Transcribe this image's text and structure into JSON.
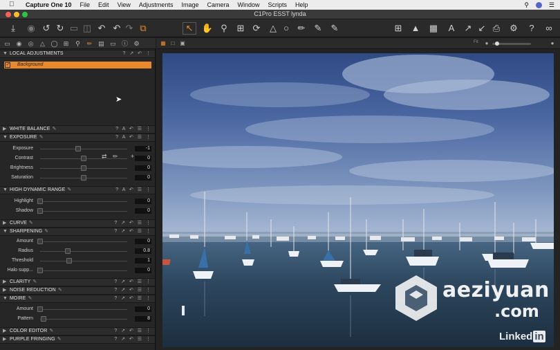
{
  "menubar": {
    "app_name": "Capture One 10",
    "items": [
      "File",
      "Edit",
      "View",
      "Adjustments",
      "Image",
      "Camera",
      "Window",
      "Scripts",
      "Help"
    ],
    "right_icons": [
      "search-icon",
      "siri-icon",
      "list-icon"
    ]
  },
  "window": {
    "title": "C1Pro ESST lynda"
  },
  "toolbar": {
    "left_icons": [
      "import-icon",
      "camera-icon",
      "rotate-left-icon",
      "rotate-right-icon",
      "folder-icon",
      "trash-icon",
      "undo-all-icon",
      "undo-icon",
      "redo-icon",
      "copy-adjustments-icon"
    ],
    "cursor_tools": [
      "select-cursor-icon",
      "pan-icon",
      "zoom-icon",
      "crop-icon",
      "rotate-icon",
      "keystone-icon",
      "spot-icon",
      "brush-icon",
      "picker-icon",
      "annotation-icon"
    ],
    "right_icons": [
      "grid-view-icon",
      "warning-icon",
      "grid-icon",
      "text-icon",
      "expand-icon",
      "collapse-icon",
      "print-icon",
      "settings-icon",
      "help-icon",
      "glasses-icon"
    ]
  },
  "tool_tabs": [
    "library-tab",
    "capture-tab",
    "color-tab",
    "exposure-tab",
    "lens-tab",
    "crop-tab",
    "details-tab",
    "local-adjustments-tab",
    "metadata-tab",
    "output-tab",
    "batch-tab",
    "tweaks-tab"
  ],
  "local_adjustments": {
    "header": "LOCAL ADJUSTMENTS",
    "layer_name": "Background"
  },
  "sections": {
    "white_balance": "WHITE BALANCE",
    "exposure": "EXPOSURE",
    "hdr": "HIGH DYNAMIC RANGE",
    "curve": "CURVE",
    "sharpening": "SHARPENING",
    "clarity": "CLARITY",
    "noise": "NOISE REDUCTION",
    "moire": "MOIRE",
    "color_editor": "COLOR EDITOR",
    "purple_fringing": "PURPLE FRINGING"
  },
  "exposure_sliders": [
    {
      "label": "Exposure",
      "value": "-1",
      "level": -0.125
    },
    {
      "label": "Contrast",
      "value": "0",
      "level": 0
    },
    {
      "label": "Brightness",
      "value": "0",
      "level": 0
    },
    {
      "label": "Saturation",
      "value": "0",
      "level": 0
    }
  ],
  "hdr_sliders": [
    {
      "label": "Highlight",
      "value": "0",
      "level": 0
    },
    {
      "label": "Shadow",
      "value": "0",
      "level": 0
    }
  ],
  "sharpening_sliders": [
    {
      "label": "Amount",
      "value": "0",
      "level": 0
    },
    {
      "label": "Radius",
      "value": "0.8",
      "level": 0.32
    },
    {
      "label": "Threshold",
      "value": "1",
      "level": 0.33
    },
    {
      "label": "Halo supp...",
      "value": "0",
      "level": 0
    }
  ],
  "moire_sliders": [
    {
      "label": "Amount",
      "value": "0",
      "level": 0
    },
    {
      "label": "Pattern",
      "value": "8",
      "level": 0.04
    }
  ],
  "viewer": {
    "fit_label": "Fit",
    "view_modes": [
      "multi-view-icon",
      "single-view-icon",
      "compare-view-icon"
    ]
  },
  "watermark": {
    "line1": "aeziyuan",
    "line2": ".com",
    "linkedin_prefix": "Linked",
    "linkedin_suffix": "in"
  }
}
